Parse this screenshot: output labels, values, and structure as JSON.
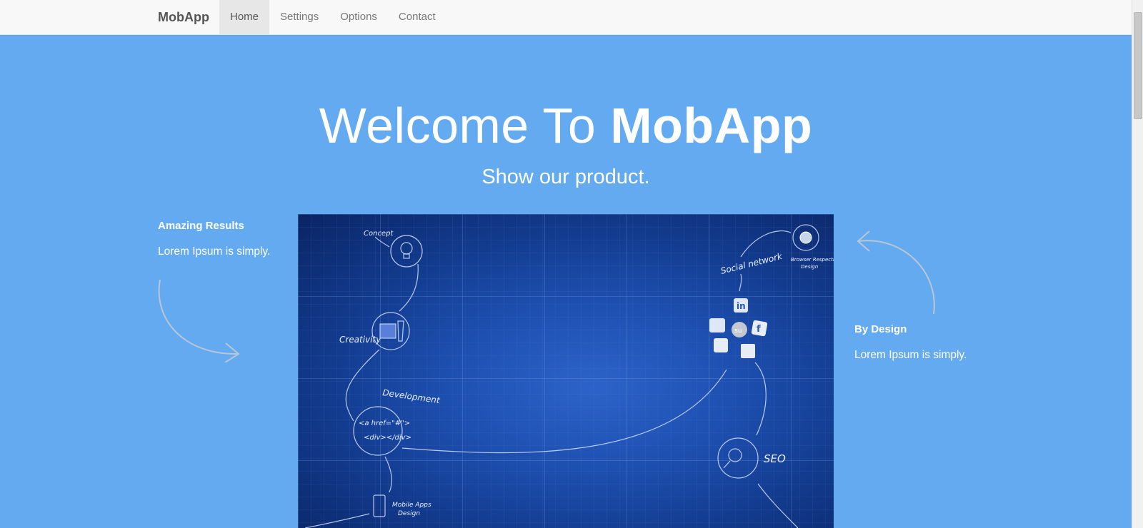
{
  "navbar": {
    "brand": "MobApp",
    "items": [
      {
        "label": "Home",
        "active": true
      },
      {
        "label": "Settings",
        "active": false
      },
      {
        "label": "Options",
        "active": false
      },
      {
        "label": "Contact",
        "active": false
      }
    ]
  },
  "hero": {
    "title_light": "Welcome To ",
    "title_bold": "MobApp",
    "subtitle": "Show our product."
  },
  "features": {
    "left": {
      "title": "Amazing Results",
      "text": "Lorem Ipsum is simply."
    },
    "right": {
      "title": "By Design",
      "text": "Lorem Ipsum is simply."
    }
  },
  "image": {
    "labels": {
      "concept": "Concept",
      "creativity": "Creativity",
      "development": "Development",
      "code_line1": "<a href=\"#\">",
      "code_line2": "<div></div>",
      "mobile_line1": "Mobile Apps",
      "mobile_line2": "Design",
      "social": "Social network",
      "browser_line1": "Browser Respective",
      "browser_line2": "Design",
      "seo": "SEO",
      "social_icons": [
        "in",
        "su",
        "f"
      ]
    }
  },
  "colors": {
    "background": "#64aaf0",
    "navbar": "#f8f8f8",
    "nav_active": "#e7e7e7",
    "image_blue": "#1d4fb0"
  }
}
